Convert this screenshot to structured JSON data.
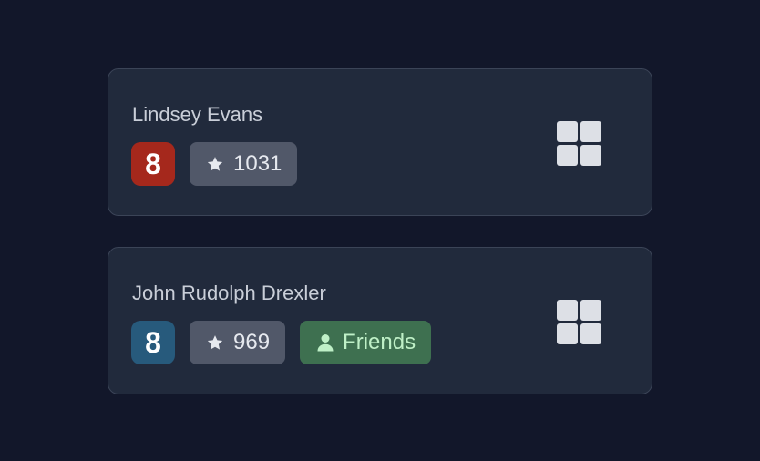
{
  "players": [
    {
      "name": "Lindsey Evans",
      "level": "8",
      "level_color": "#a5281c",
      "rating": "1031",
      "rating_icon": "star-icon",
      "action_icon": "grid-icon"
    },
    {
      "name": "John Rudolph Drexler",
      "level": "8",
      "level_color": "#275a7c",
      "rating": "969",
      "rating_icon": "star-icon",
      "friend_badge": "Friends",
      "friend_icon": "person-icon",
      "action_icon": "grid-icon"
    }
  ],
  "colors": {
    "background": "#12172a",
    "card": "#212a3c",
    "rating_chip": "#515869",
    "friends_chip": "#3e7050",
    "friends_text": "#bff0c7"
  }
}
